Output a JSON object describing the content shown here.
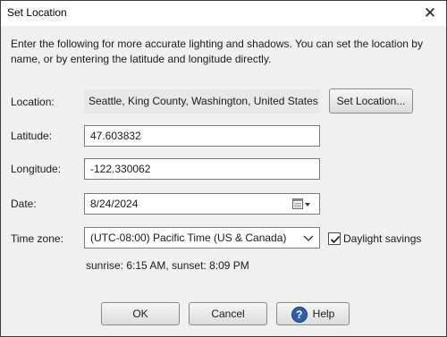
{
  "window": {
    "title": "Set Location",
    "close_icon": "close-icon",
    "close_glyph": "✕"
  },
  "intro_text": "Enter the following for more accurate lighting and shadows. You can set the location by name, or by entering the latitude and longitude directly.",
  "location": {
    "label": "Location:",
    "value": "Seattle, King County, Washington, United States",
    "button_label": "Set Location..."
  },
  "latitude": {
    "label": "Latitude:",
    "value": "47.603832"
  },
  "longitude": {
    "label": "Longitude:",
    "value": "-122.330062"
  },
  "date": {
    "label": "Date:",
    "value": "8/24/2024",
    "icon": "calendar-dropdown-icon"
  },
  "timezone": {
    "label": "Time zone:",
    "selected": "(UTC-08:00) Pacific Time (US & Canada)",
    "icon": "chevron-down-icon"
  },
  "daylight_savings": {
    "label": "Daylight savings",
    "checked": true
  },
  "sun_times": "sunrise: 6:15 AM, sunset: 8:09 PM",
  "buttons": {
    "ok": "OK",
    "cancel": "Cancel",
    "help": "Help",
    "help_icon": "help-icon",
    "help_glyph": "?"
  },
  "colors": {
    "dialog_background": "#f0f0f0",
    "help_icon_blue": "#2e5fa8"
  }
}
